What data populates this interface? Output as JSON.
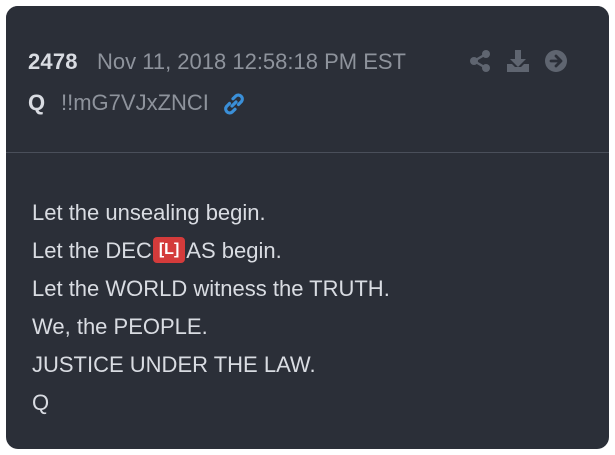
{
  "post": {
    "number": "2478",
    "timestamp": "Nov 11, 2018 12:58:18 PM EST",
    "author": "Q",
    "tripcode": "!!mG7VJxZNCI"
  },
  "icons": {
    "link": "link-icon",
    "share": "share-icon",
    "download": "download-icon",
    "next": "arrow-right-icon"
  },
  "body": {
    "line1": "Let the unsealing begin.",
    "line2_pre": "Let the DEC",
    "line2_badge": "[L]",
    "line2_post": "AS begin.",
    "line3": "Let the WORLD witness the TRUTH.",
    "line4": "We, the PEOPLE.",
    "line5": "JUSTICE UNDER THE LAW.",
    "line6": "Q"
  },
  "colors": {
    "card_bg": "#2b2f38",
    "text": "#d9dce2",
    "muted": "#8e939c",
    "link_blue": "#3a8fd8",
    "badge_red": "#d43b3b"
  }
}
